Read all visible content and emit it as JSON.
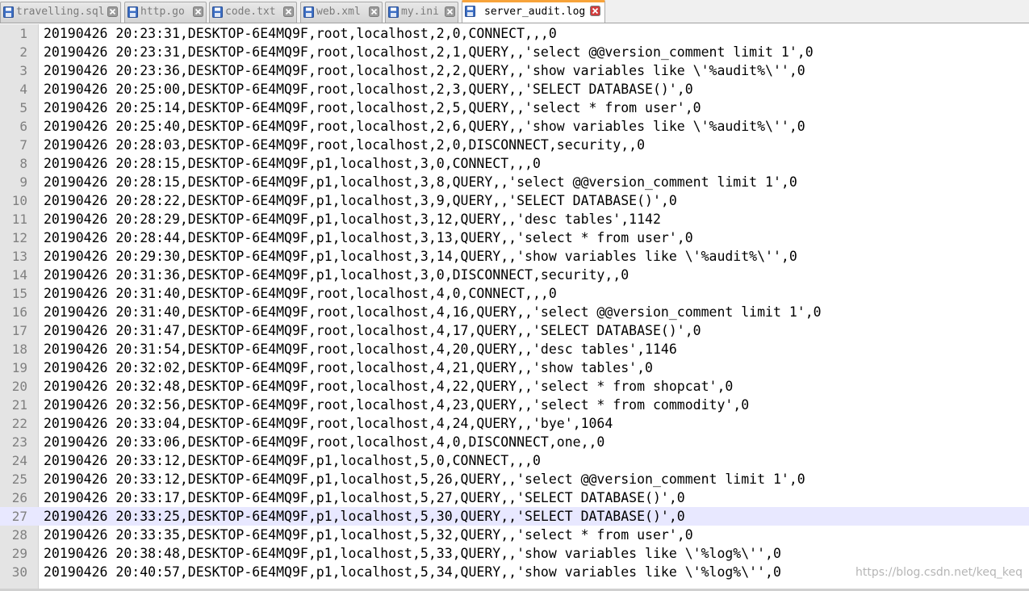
{
  "tabs": [
    {
      "label": "travelling.sql",
      "icon": "file-icon",
      "active": false
    },
    {
      "label": "http.go",
      "icon": "file-icon",
      "active": false
    },
    {
      "label": "code.txt",
      "icon": "file-icon",
      "active": false
    },
    {
      "label": "web.xml",
      "icon": "file-icon",
      "active": false
    },
    {
      "label": "my.ini",
      "icon": "file-icon",
      "active": false
    },
    {
      "label": "server_audit.log",
      "icon": "file-icon",
      "active": true
    }
  ],
  "colors": {
    "active_tab_accent": "#f7a33a",
    "close_icon": "#d23d3d",
    "file_icon": "#3d6fc4",
    "current_line": "#e8e8ff",
    "gutter": "#e4e4e4"
  },
  "editor": {
    "current_line": 27,
    "lines": [
      {
        "n": "1",
        "text": "20190426 20:23:31,DESKTOP-6E4MQ9F,root,localhost,2,0,CONNECT,,,0"
      },
      {
        "n": "2",
        "text": "20190426 20:23:31,DESKTOP-6E4MQ9F,root,localhost,2,1,QUERY,,'select @@version_comment limit 1',0"
      },
      {
        "n": "3",
        "text": "20190426 20:23:36,DESKTOP-6E4MQ9F,root,localhost,2,2,QUERY,,'show variables like \\'%audit%\\'',0"
      },
      {
        "n": "4",
        "text": "20190426 20:25:00,DESKTOP-6E4MQ9F,root,localhost,2,3,QUERY,,'SELECT DATABASE()',0"
      },
      {
        "n": "5",
        "text": "20190426 20:25:14,DESKTOP-6E4MQ9F,root,localhost,2,5,QUERY,,'select * from user',0"
      },
      {
        "n": "6",
        "text": "20190426 20:25:40,DESKTOP-6E4MQ9F,root,localhost,2,6,QUERY,,'show variables like \\'%audit%\\'',0"
      },
      {
        "n": "7",
        "text": "20190426 20:28:03,DESKTOP-6E4MQ9F,root,localhost,2,0,DISCONNECT,security,,0"
      },
      {
        "n": "8",
        "text": "20190426 20:28:15,DESKTOP-6E4MQ9F,p1,localhost,3,0,CONNECT,,,0"
      },
      {
        "n": "9",
        "text": "20190426 20:28:15,DESKTOP-6E4MQ9F,p1,localhost,3,8,QUERY,,'select @@version_comment limit 1',0"
      },
      {
        "n": "10",
        "text": "20190426 20:28:22,DESKTOP-6E4MQ9F,p1,localhost,3,9,QUERY,,'SELECT DATABASE()',0"
      },
      {
        "n": "11",
        "text": "20190426 20:28:29,DESKTOP-6E4MQ9F,p1,localhost,3,12,QUERY,,'desc tables',1142"
      },
      {
        "n": "12",
        "text": "20190426 20:28:44,DESKTOP-6E4MQ9F,p1,localhost,3,13,QUERY,,'select * from user',0"
      },
      {
        "n": "13",
        "text": "20190426 20:29:30,DESKTOP-6E4MQ9F,p1,localhost,3,14,QUERY,,'show variables like \\'%audit%\\'',0"
      },
      {
        "n": "14",
        "text": "20190426 20:31:36,DESKTOP-6E4MQ9F,p1,localhost,3,0,DISCONNECT,security,,0"
      },
      {
        "n": "15",
        "text": "20190426 20:31:40,DESKTOP-6E4MQ9F,root,localhost,4,0,CONNECT,,,0"
      },
      {
        "n": "16",
        "text": "20190426 20:31:40,DESKTOP-6E4MQ9F,root,localhost,4,16,QUERY,,'select @@version_comment limit 1',0"
      },
      {
        "n": "17",
        "text": "20190426 20:31:47,DESKTOP-6E4MQ9F,root,localhost,4,17,QUERY,,'SELECT DATABASE()',0"
      },
      {
        "n": "18",
        "text": "20190426 20:31:54,DESKTOP-6E4MQ9F,root,localhost,4,20,QUERY,,'desc tables',1146"
      },
      {
        "n": "19",
        "text": "20190426 20:32:02,DESKTOP-6E4MQ9F,root,localhost,4,21,QUERY,,'show tables',0"
      },
      {
        "n": "20",
        "text": "20190426 20:32:48,DESKTOP-6E4MQ9F,root,localhost,4,22,QUERY,,'select * from shopcat',0"
      },
      {
        "n": "21",
        "text": "20190426 20:32:56,DESKTOP-6E4MQ9F,root,localhost,4,23,QUERY,,'select * from commodity',0"
      },
      {
        "n": "22",
        "text": "20190426 20:33:04,DESKTOP-6E4MQ9F,root,localhost,4,24,QUERY,,'bye',1064"
      },
      {
        "n": "23",
        "text": "20190426 20:33:06,DESKTOP-6E4MQ9F,root,localhost,4,0,DISCONNECT,one,,0"
      },
      {
        "n": "24",
        "text": "20190426 20:33:12,DESKTOP-6E4MQ9F,p1,localhost,5,0,CONNECT,,,0"
      },
      {
        "n": "25",
        "text": "20190426 20:33:12,DESKTOP-6E4MQ9F,p1,localhost,5,26,QUERY,,'select @@version_comment limit 1',0"
      },
      {
        "n": "26",
        "text": "20190426 20:33:17,DESKTOP-6E4MQ9F,p1,localhost,5,27,QUERY,,'SELECT DATABASE()',0"
      },
      {
        "n": "27",
        "text": "20190426 20:33:25,DESKTOP-6E4MQ9F,p1,localhost,5,30,QUERY,,'SELECT DATABASE()',0"
      },
      {
        "n": "28",
        "text": "20190426 20:33:35,DESKTOP-6E4MQ9F,p1,localhost,5,32,QUERY,,'select * from user',0"
      },
      {
        "n": "29",
        "text": "20190426 20:38:48,DESKTOP-6E4MQ9F,p1,localhost,5,33,QUERY,,'show variables like \\'%log%\\'',0"
      },
      {
        "n": "30",
        "text": "20190426 20:40:57,DESKTOP-6E4MQ9F,p1,localhost,5,34,QUERY,,'show variables like \\'%log%\\'',0"
      }
    ]
  },
  "watermark": "https://blog.csdn.net/keq_keq"
}
